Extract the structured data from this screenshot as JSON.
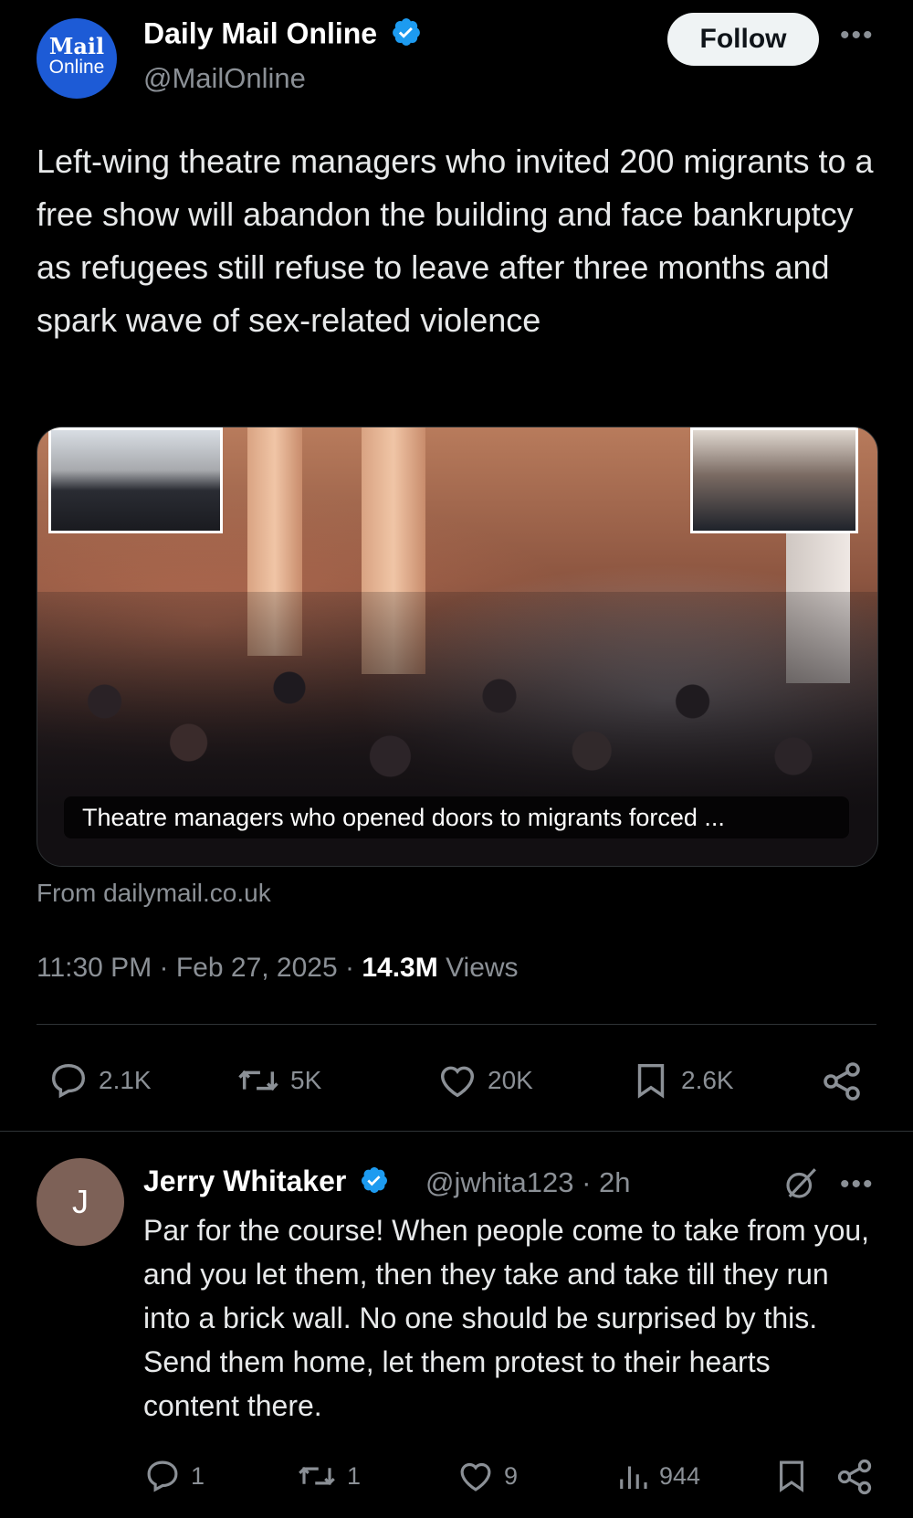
{
  "tweet": {
    "avatar_line1": "Mail",
    "avatar_line2": "Online",
    "display_name": "Daily Mail Online",
    "handle": "@MailOnline",
    "follow_label": "Follow",
    "more_icon": "more-dots-icon",
    "text": "Left-wing theatre managers who invited 200 migrants to a free show will abandon the building and face bankruptcy as refugees still refuse to leave after three months and spark wave of sex-related violence",
    "media_caption": "Theatre managers who opened doors to migrants forced ...",
    "source": "From dailymail.co.uk",
    "time": "11:30 PM",
    "date": "Feb 27, 2025",
    "views_count": "14.3M",
    "views_label": "Views",
    "actions": {
      "replies": "2.1K",
      "reposts": "5K",
      "likes": "20K",
      "bookmarks": "2.6K"
    }
  },
  "reply": {
    "avatar_letter": "J",
    "display_name": "Jerry Whitaker",
    "handle": "@jwhita123",
    "age": "2h",
    "text": "Par for the course! When people come to take from you, and you let them, then they take and take till they run into a brick wall. No one should be surprised by this. Send them home, let them protest to their hearts content there.",
    "actions": {
      "replies": "1",
      "reposts": "1",
      "likes": "9",
      "views": "944"
    }
  },
  "colors": {
    "background": "#000000",
    "text": "#e7e9ea",
    "muted": "#8b9096",
    "verified": "#1d9bf0",
    "divider": "#2f3336"
  }
}
